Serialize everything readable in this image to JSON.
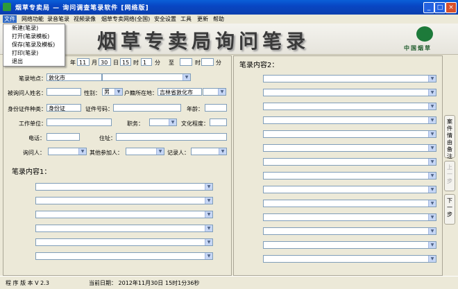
{
  "window": {
    "title": "烟草专卖局 — 询问调查笔录软件  [网络版]"
  },
  "menu": [
    "文件",
    "网络功能",
    "录音笔录",
    "视频录像",
    "烟草专卖网络(全国)",
    "安全设置",
    "工具",
    "更新",
    "帮助"
  ],
  "file_menu": [
    "新建(笔录)",
    "打开(笔录模板)",
    "保存(笔录及模板)",
    "打印(笔录)",
    "退出"
  ],
  "header": {
    "title": "烟草专卖局询问笔录",
    "logo_text": "中国烟草"
  },
  "time_row": {
    "month_label": "年",
    "month": "11",
    "month_unit": "月",
    "day": "30",
    "day_unit": "日",
    "hour": "15",
    "hour_unit": "时",
    "minute": "1",
    "minute_unit": "分",
    "to_label": "至",
    "hour2": "",
    "hour2_unit": "时",
    "minute2": "",
    "minute2_unit": "分"
  },
  "form": {
    "location_label": "笔录地点：",
    "location_value": "敦化市",
    "name_label": "被询问人姓名：",
    "gender_label": "性别：",
    "gender_value": "男",
    "hukou_label": "户籍所在地：",
    "hukou_value": "吉林省敦化市",
    "id_type_label": "身份证件种类：",
    "id_type_value": "身份证",
    "id_no_label": "证件号码：",
    "age_label": "年龄：",
    "work_label": "工作单位：",
    "job_label": "职务：",
    "edu_label": "文化程度：",
    "phone_label": "电话：",
    "address_label": "住址：",
    "inquirer_label": "询问人：",
    "other_label": "其他参加人：",
    "recorder_label": "记录人："
  },
  "content1": {
    "title": "笔录内容1："
  },
  "content2": {
    "title": "笔录内容2："
  },
  "side": {
    "case_tab": "案件情由备注",
    "prev_tab": "上一步",
    "next_tab": "下一步"
  },
  "status": {
    "version": "程 序 版 本 V 2.3",
    "date": "当前日期：  2012年11月30日",
    "time": "15时1分36秒"
  }
}
